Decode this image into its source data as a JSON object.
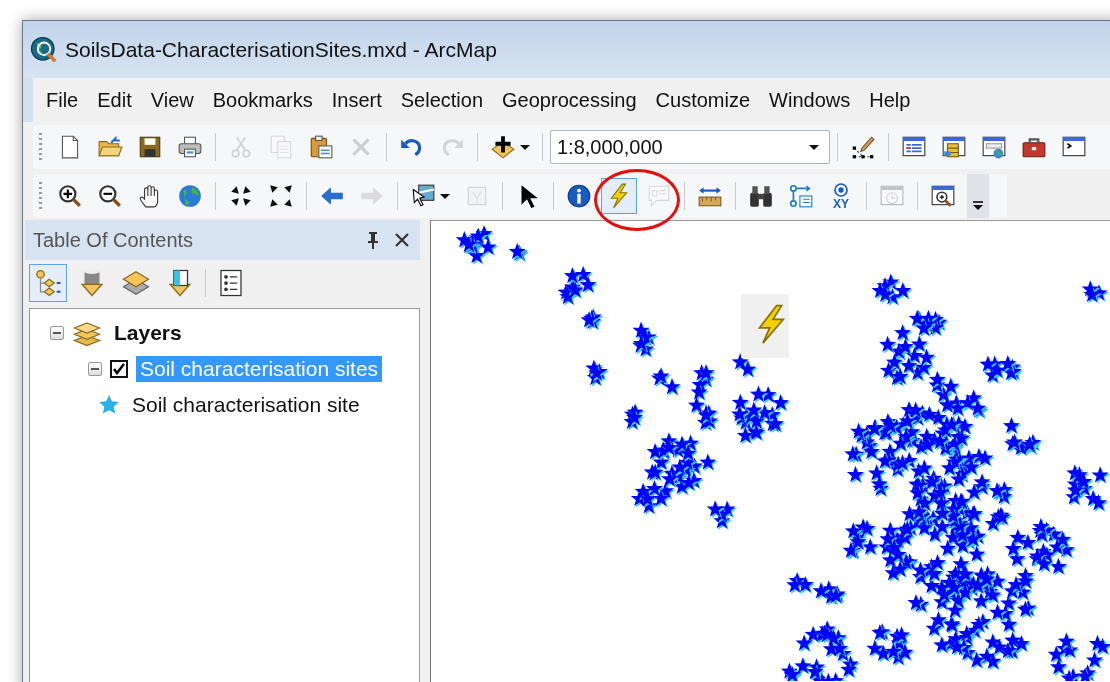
{
  "window": {
    "title": "SoilsData-CharacterisationSites.mxd - ArcMap"
  },
  "menu": [
    "File",
    "Edit",
    "View",
    "Bookmarks",
    "Insert",
    "Selection",
    "Geoprocessing",
    "Customize",
    "Windows",
    "Help"
  ],
  "toolbars": [
    {
      "items": [
        {
          "kind": "tool",
          "disabled": false,
          "active": false
        },
        {
          "kind": "tool",
          "disabled": false,
          "active": false
        },
        {
          "kind": "tool",
          "disabled": false,
          "active": false
        },
        {
          "kind": "tool",
          "disabled": false,
          "active": false
        },
        {
          "kind": "separator"
        },
        {
          "kind": "tool",
          "disabled": true,
          "active": false
        },
        {
          "kind": "tool",
          "disabled": true,
          "active": false
        },
        {
          "kind": "tool",
          "disabled": false,
          "active": false
        },
        {
          "kind": "tool",
          "disabled": true,
          "active": false
        },
        {
          "kind": "separator"
        },
        {
          "kind": "tool",
          "disabled": false,
          "active": false
        },
        {
          "kind": "tool",
          "disabled": true,
          "active": false
        },
        {
          "kind": "separator"
        },
        {
          "kind": "split",
          "disabled": false,
          "active": false
        },
        {
          "kind": "separator"
        },
        {
          "kind": "scale",
          "value": "1:8,000,000"
        },
        {
          "kind": "separator"
        },
        {
          "kind": "tool",
          "disabled": false,
          "active": false
        },
        {
          "kind": "separator"
        },
        {
          "kind": "tool",
          "disabled": false,
          "active": false
        },
        {
          "kind": "tool",
          "disabled": false,
          "active": false
        },
        {
          "kind": "tool",
          "disabled": false,
          "active": false
        },
        {
          "kind": "tool",
          "disabled": false,
          "active": false
        },
        {
          "kind": "tool",
          "disabled": false,
          "active": false
        }
      ]
    },
    {
      "items": [
        {
          "kind": "tool",
          "disabled": false,
          "active": false
        },
        {
          "kind": "tool",
          "disabled": false,
          "active": false
        },
        {
          "kind": "tool",
          "disabled": false,
          "active": false
        },
        {
          "kind": "tool",
          "disabled": false,
          "active": false
        },
        {
          "kind": "separator"
        },
        {
          "kind": "tool",
          "disabled": false,
          "active": false
        },
        {
          "kind": "tool",
          "disabled": false,
          "active": false
        },
        {
          "kind": "separator"
        },
        {
          "kind": "tool",
          "disabled": false,
          "active": false
        },
        {
          "kind": "tool",
          "disabled": true,
          "active": false
        },
        {
          "kind": "separator"
        },
        {
          "kind": "split",
          "disabled": false,
          "active": false
        },
        {
          "kind": "tool",
          "disabled": true,
          "active": false
        },
        {
          "kind": "separator"
        },
        {
          "kind": "tool",
          "disabled": false,
          "active": false
        },
        {
          "kind": "separator"
        },
        {
          "kind": "tool",
          "disabled": false,
          "active": false
        },
        {
          "kind": "tool",
          "disabled": false,
          "active": true
        },
        {
          "kind": "tool",
          "disabled": true,
          "active": false
        },
        {
          "kind": "separator"
        },
        {
          "kind": "tool",
          "disabled": false,
          "active": false
        },
        {
          "kind": "separator"
        },
        {
          "kind": "tool",
          "disabled": false,
          "active": false
        },
        {
          "kind": "tool",
          "disabled": false,
          "active": false
        },
        {
          "kind": "tool",
          "disabled": false,
          "active": false,
          "label": "XY"
        },
        {
          "kind": "separator"
        },
        {
          "kind": "tool",
          "disabled": true,
          "active": false
        },
        {
          "kind": "separator"
        },
        {
          "kind": "tool",
          "disabled": false,
          "active": false
        },
        {
          "kind": "overflow"
        }
      ]
    }
  ],
  "toc": {
    "title": "Table Of Contents",
    "tabs": [
      {
        "selected": true
      },
      {
        "selected": false
      },
      {
        "selected": false
      },
      {
        "selected": false
      },
      {
        "selected": false
      }
    ],
    "tree": [
      {
        "kind": "group",
        "label": "Layers",
        "expanded": true,
        "children": [
          {
            "kind": "layer",
            "label": "Soil characterisation sites",
            "expanded": true,
            "checked": true,
            "selected": true,
            "children": [
              {
                "kind": "legend",
                "label": "Soil characterisation site"
              }
            ]
          }
        ]
      }
    ]
  }
}
